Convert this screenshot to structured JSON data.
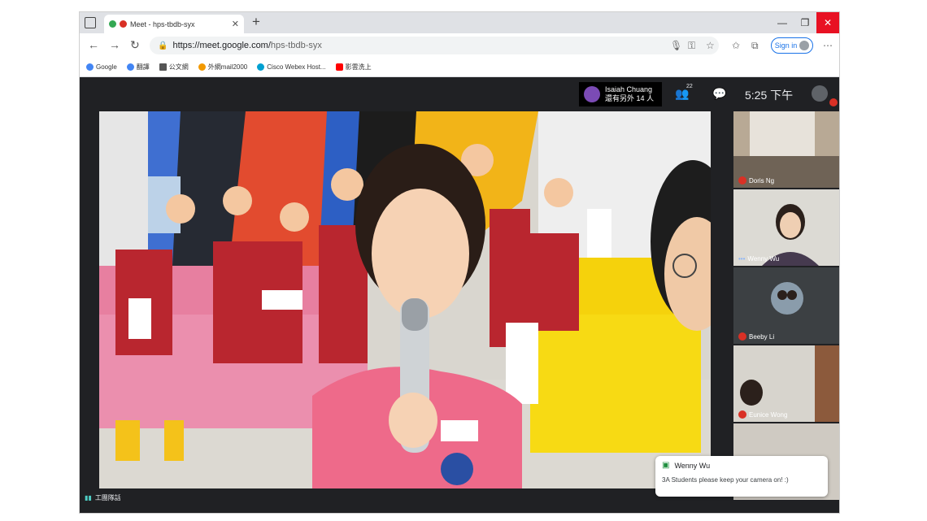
{
  "browser": {
    "tab_title": "Meet - hps-tbdb-syx",
    "url_host": "https://meet.google.com/",
    "url_path": "hps-tbdb-syx",
    "signin_label": "Sign in",
    "bookmarks": [
      {
        "label": "Google",
        "icon": "google-icon",
        "color": "#4285f4"
      },
      {
        "label": "翻譯",
        "icon": "google-translate-icon",
        "color": "#4285f4"
      },
      {
        "label": "公文網",
        "icon": "document-icon",
        "color": "#555555"
      },
      {
        "label": "外網mail2000",
        "icon": "mail-icon",
        "color": "#f29900"
      },
      {
        "label": "Cisco Webex Host...",
        "icon": "webex-icon",
        "color": "#00a0d1"
      },
      {
        "label": "影雲洗上",
        "icon": "youtube-icon",
        "color": "#ff0000"
      }
    ]
  },
  "meet": {
    "presenter_name": "Isaiah Chuang",
    "presenter_sub": "還有另外 14 人",
    "people_count": "22",
    "clock": "5:25 下午",
    "speaker_label": "工團隊話",
    "tiles": [
      {
        "name": "Doris Ng",
        "muted": true
      },
      {
        "name": "Wenny Wu",
        "muted": false
      },
      {
        "name": "Beeby Li",
        "muted": true
      },
      {
        "name": "Eunice Wong",
        "muted": true
      }
    ],
    "chat_toast": {
      "from": "Wenny Wu",
      "message": "3A Students please keep your camera on! :)"
    }
  },
  "colors": {
    "accent": "#1a73e8",
    "meet_bg": "#202124",
    "close": "#e81123",
    "mute": "#d93025"
  }
}
